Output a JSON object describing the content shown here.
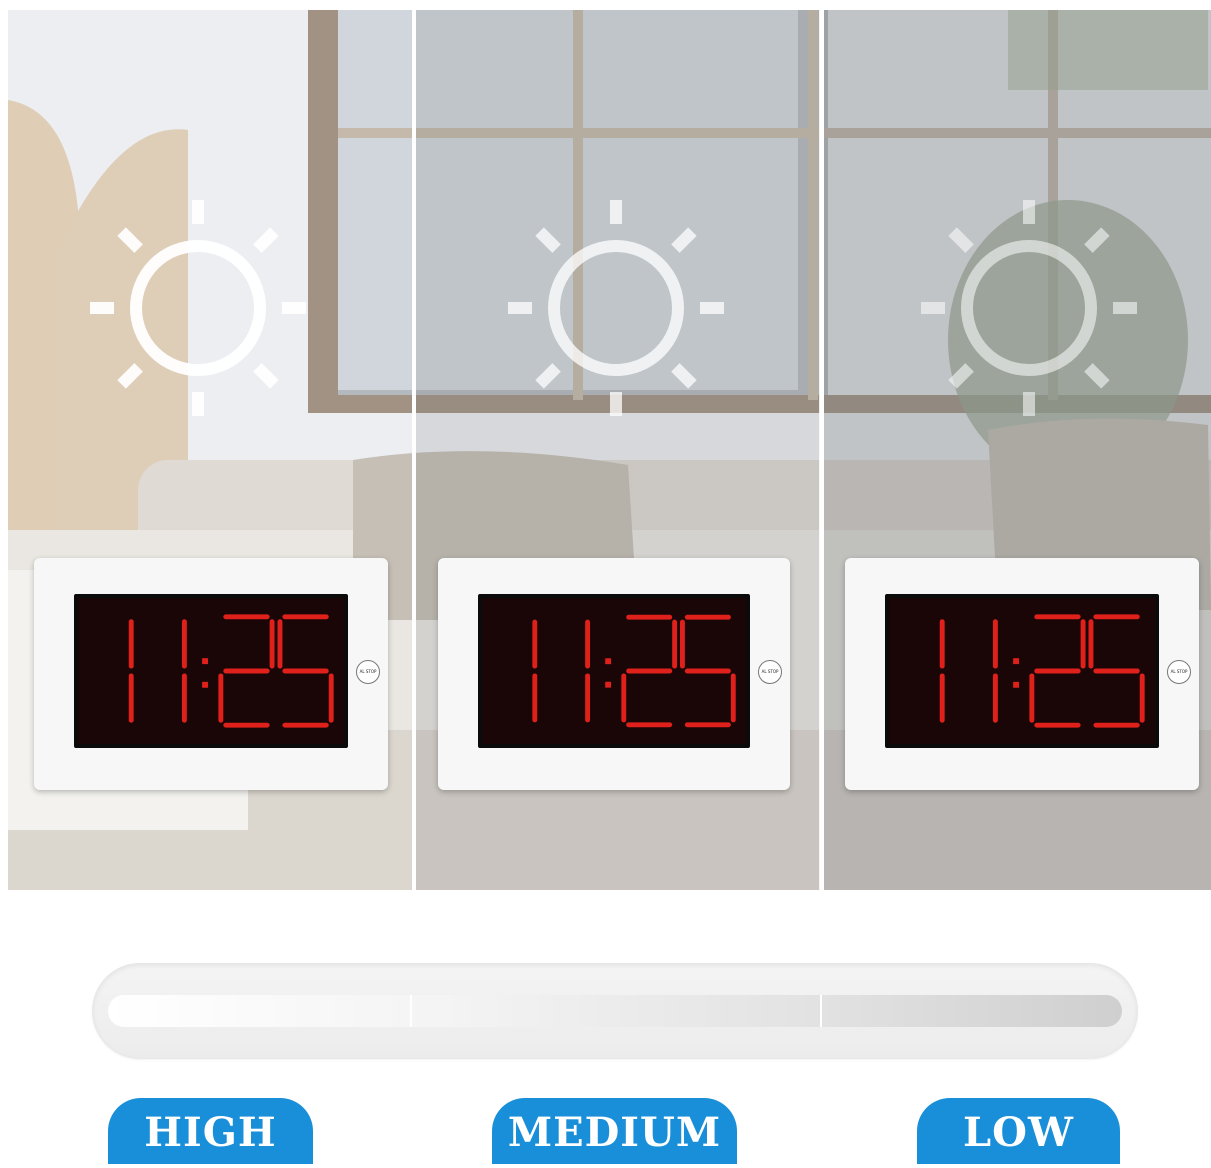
{
  "clock": {
    "time": "11:25",
    "button": "AL STOP"
  },
  "levels": [
    {
      "label": "HIGH",
      "brightness": 1.0
    },
    {
      "label": "MEDIUM",
      "brightness": 0.66
    },
    {
      "label": "LOW",
      "brightness": 0.33
    }
  ],
  "colors": {
    "badge": "#1a8fd9",
    "digits": "#e0201a"
  },
  "icons": [
    "sun-icon"
  ]
}
